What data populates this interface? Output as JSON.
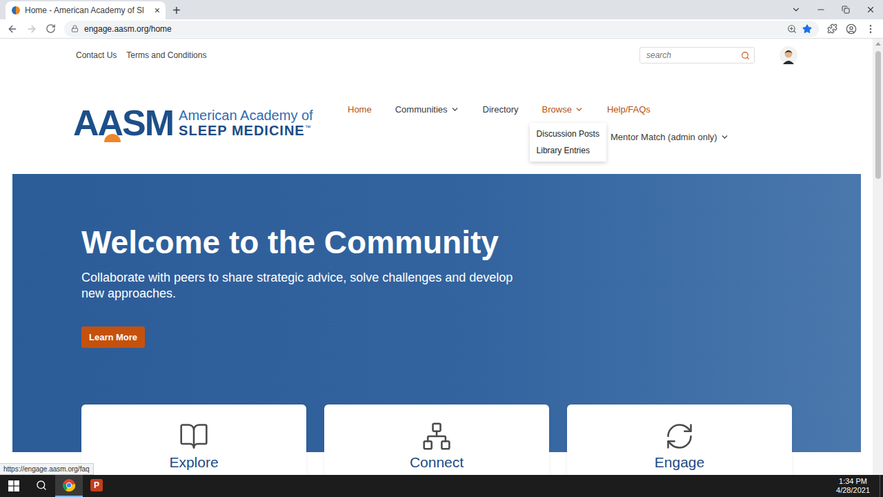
{
  "browser": {
    "tab_title": "Home - American Academy of Sl",
    "close": "×",
    "new_tab": "+",
    "url": "engage.aasm.org/home"
  },
  "utility_links": [
    "Contact Us",
    "Terms and Conditions"
  ],
  "search": {
    "placeholder": "search"
  },
  "logo": {
    "mark": "AASM",
    "line1": "American Academy of",
    "line2": "SLEEP MEDICINE",
    "tm": "™"
  },
  "nav": {
    "rows": [
      [
        {
          "label": "Home",
          "dropdown": false,
          "highlighted": true
        },
        {
          "label": "Communities",
          "dropdown": true,
          "highlighted": false
        },
        {
          "label": "Directory",
          "dropdown": false,
          "highlighted": false
        },
        {
          "label": "Browse",
          "dropdown": true,
          "highlighted": true,
          "expanded": true
        },
        {
          "label": "Help/FAQs",
          "dropdown": false,
          "highlighted": true
        }
      ],
      [
        {
          "label": "Mentor Match (admin only)",
          "dropdown": true,
          "highlighted": false
        }
      ]
    ]
  },
  "browse_menu": {
    "items": [
      "Discussion Posts",
      "Library Entries"
    ]
  },
  "hero": {
    "title": "Welcome to the Community",
    "subtitle": "Collaborate with peers to share strategic advice, solve challenges and develop new approaches.",
    "button": "Learn More"
  },
  "cards": [
    {
      "title": "Explore",
      "kind": "explore"
    },
    {
      "title": "Connect",
      "kind": "connect"
    },
    {
      "title": "Engage",
      "kind": "engage"
    }
  ],
  "status_url": "https://engage.aasm.org/faq",
  "taskbar": {
    "time": "1:34 PM",
    "date": "4/28/2021",
    "apps": [
      {
        "kind": "chrome",
        "selected": true
      },
      {
        "kind": "powerpoint",
        "label": "P",
        "selected": false
      }
    ]
  }
}
